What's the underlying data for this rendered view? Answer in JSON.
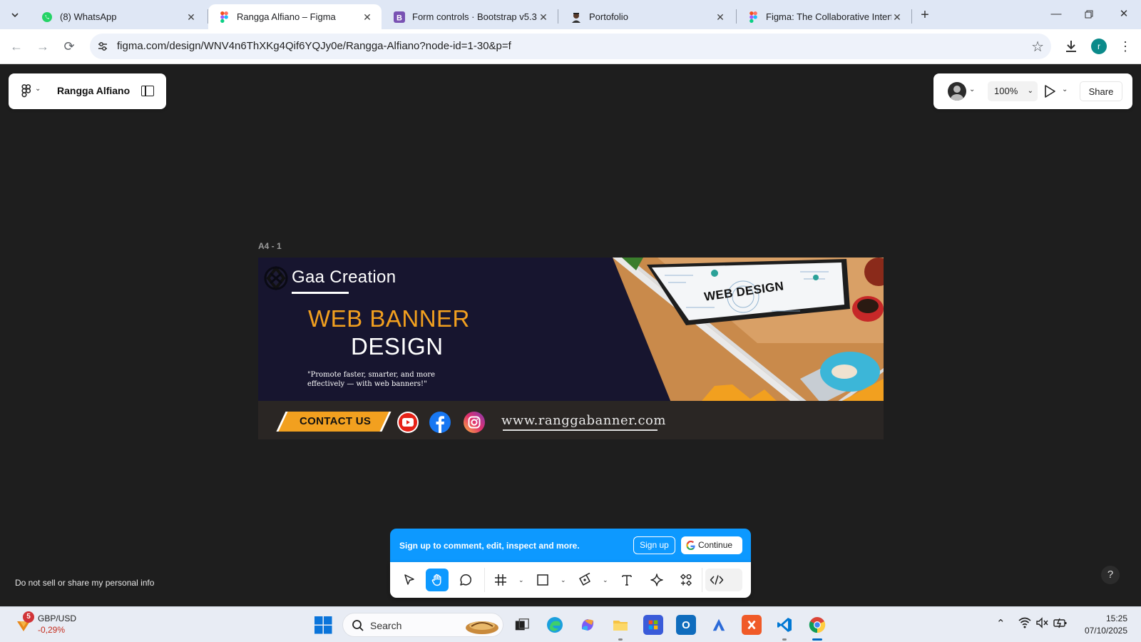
{
  "browser": {
    "tabs": [
      {
        "title": "(8) WhatsApp",
        "icon": "whatsapp-icon",
        "active": false
      },
      {
        "title": "Rangga Alfiano – Figma",
        "icon": "figma-icon",
        "active": true
      },
      {
        "title": "Form controls · Bootstrap v5.3",
        "icon": "bootstrap-icon",
        "active": false
      },
      {
        "title": "Portofolio",
        "icon": "portfolio-icon",
        "active": false
      },
      {
        "title": "Figma: The Collaborative Interfa",
        "icon": "figma-icon",
        "active": false
      }
    ],
    "url": "figma.com/design/WNV4n6ThXKg4Qif6YQJy0e/Rangga-Alfiano?node-id=1-30&p=f",
    "profile_initial": "r"
  },
  "figma": {
    "file_name": "Rangga Alfiano",
    "zoom": "100%",
    "share_label": "Share",
    "frame_label": "A4 - 1",
    "signup_message": "Sign up to comment, edit, inspect and more.",
    "signup_button": "Sign up",
    "continue_button": "Continue",
    "privacy_link": "Do not sell or share my personal info",
    "help_label": "?",
    "tools": [
      "move-tool",
      "hand-tool",
      "comment-tool",
      "frame-tool",
      "shape-tool",
      "pen-tool",
      "text-tool",
      "actions-tool",
      "components-tool",
      "dev-mode-toggle"
    ],
    "selected_tool": "hand-tool"
  },
  "banner": {
    "brand": "Gaa Creation",
    "headline_1": "WEB BANNER",
    "headline_2": "DESIGN",
    "quote": "\"Promote faster, smarter, and more effectively — with web banners!\"",
    "cta": "CONTACT US",
    "url": "www.ranggabanner.com",
    "screen_text": "WEB DESIGN",
    "colors": {
      "background": "#17152f",
      "accent": "#f2a01f",
      "bottom_bar": "#2a2624"
    }
  },
  "taskbar": {
    "weather_badge": "5",
    "ticker_pair": "GBP/USD",
    "ticker_change": "-0,29%",
    "search_placeholder": "Search",
    "time": "15:25",
    "date": "07/10/2025"
  },
  "colors": {
    "figma_blue": "#0d99ff",
    "canvas": "#1e1e1e",
    "chrome_tabbar": "#dfe7f5"
  }
}
